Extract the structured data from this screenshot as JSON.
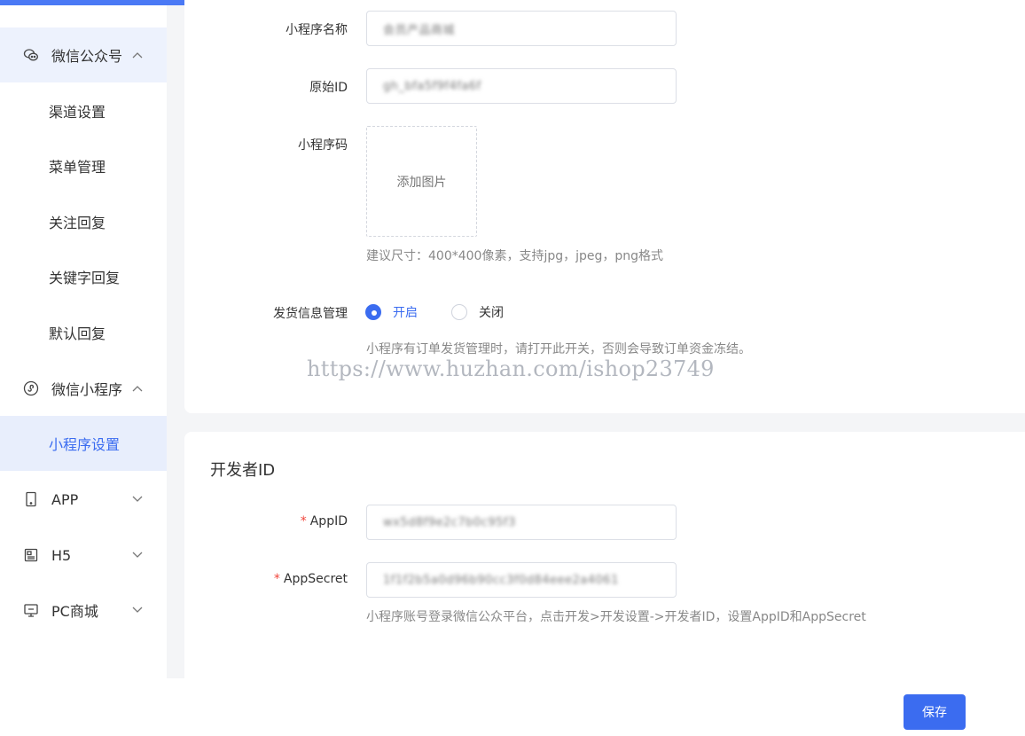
{
  "sidebar": {
    "groups": [
      {
        "label": "微信公众号",
        "icon": "wechat-icon",
        "expanded": true
      },
      {
        "label": "微信小程序",
        "icon": "miniprogram-icon",
        "expanded": true
      },
      {
        "label": "APP",
        "icon": "phone-icon",
        "expanded": false
      },
      {
        "label": "H5",
        "icon": "h5-icon",
        "expanded": false
      },
      {
        "label": "PC商城",
        "icon": "monitor-icon",
        "expanded": false
      }
    ],
    "wechat_items": [
      "渠道设置",
      "菜单管理",
      "关注回复",
      "关键字回复",
      "默认回复"
    ],
    "miniprogram_items": [
      "小程序设置"
    ],
    "active_item": "小程序设置"
  },
  "form": {
    "name_label": "小程序名称",
    "name_value": "会员产品商城",
    "original_id_label": "原始ID",
    "original_id_value": "gh_bfa5f9f4fa6f",
    "code_label": "小程序码",
    "upload_text": "添加图片",
    "size_hint": "建议尺寸：400*400像素，支持jpg，jpeg，png格式",
    "shipping_label": "发货信息管理",
    "radio_on": "开启",
    "radio_off": "关闭",
    "shipping_selected": "开启",
    "shipping_hint": "小程序有订单发货管理时，请打开此开关，否则会导致订单资金冻结。"
  },
  "watermark": "https://www.huzhan.com/ishop23749",
  "developer": {
    "title": "开发者ID",
    "required_mark": "*",
    "appid_label": "AppID",
    "appid_value": "wx5d8f9e2c7b0c95f3",
    "appsecret_label": "AppSecret",
    "appsecret_value": "1f1f2b5a0d96b90cc3f0d84eee2a4061",
    "hint": "小程序账号登录微信公众平台，点击开发>开发设置->开发者ID，设置AppID和AppSecret"
  },
  "footer": {
    "save_label": "保存"
  },
  "colors": {
    "accent": "#3b6cf0",
    "topbar": "#4a79f5",
    "active_bg": "#e8eefc",
    "required": "#f0443a"
  }
}
